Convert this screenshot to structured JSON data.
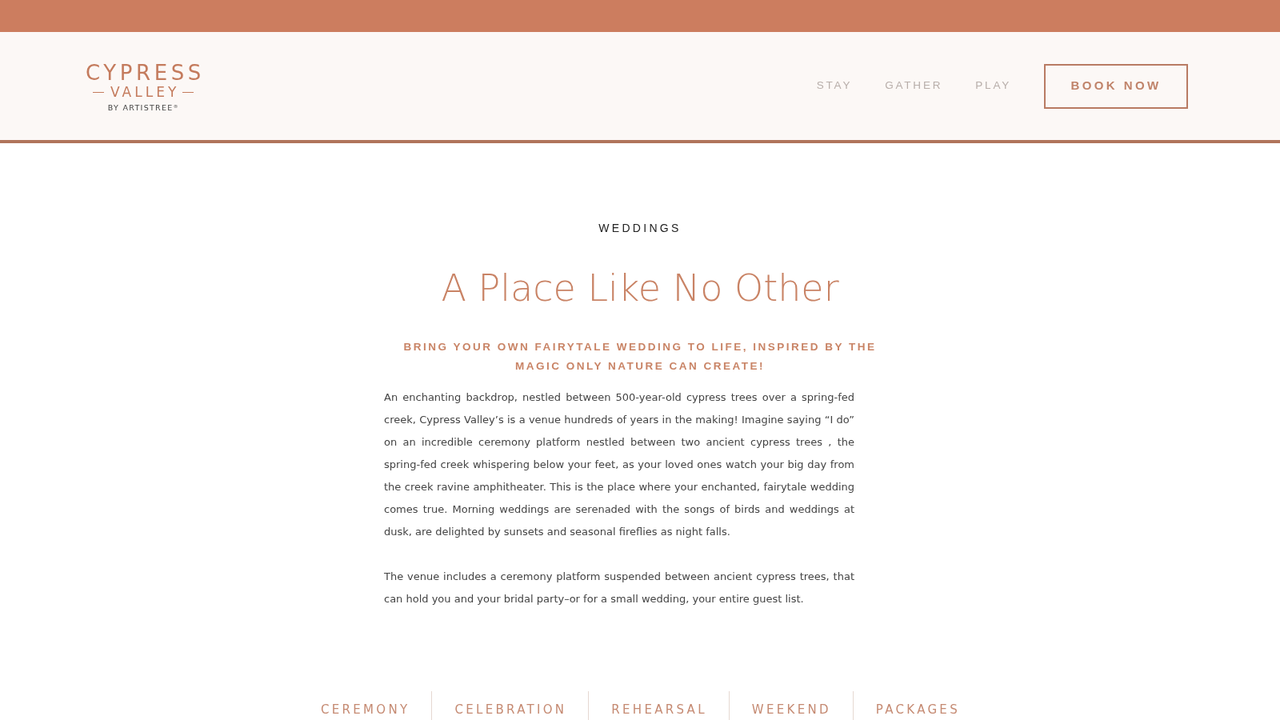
{
  "logo": {
    "line_1": "CYPRESS",
    "line_2": "VALLEY",
    "line_3": "BY ARTISTREE$^{®}$"
  },
  "nav": {
    "items": [
      {
        "label": "STAY"
      },
      {
        "label": "GATHER"
      },
      {
        "label": "PLAY"
      }
    ],
    "cta": "BOOK NOW"
  },
  "hero": {
    "eyebrow": "WEDDINGS",
    "title": "A Place Like No Other",
    "subtitle": "BRING YOUR OWN FAIRYTALE WEDDING TO LIFE, INSPIRED BY THE MAGIC ONLY NATURE CAN CREATE!",
    "paragraphs": [
      "An enchanting backdrop, nestled between 500-year-old cypress trees over a spring-fed creek, Cypress Valley’s is a venue hundreds of years in the making! Imagine saying “I do” on an incredible ceremony platform nestled between two ancient cypress trees , the spring-fed creek whispering below your feet, as your loved ones watch your big day from the creek ravine amphitheater. This is the place where your enchanted, fairytale wedding comes true. Morning weddings are serenaded with the songs of birds and weddings at dusk, are delighted by sunsets and seasonal fireflies as night falls.",
      "The venue includes a ceremony platform suspended between ancient cypress trees, that can hold you and your bridal party–or for a small wedding, your entire guest list."
    ]
  },
  "tabs": [
    {
      "label": "CEREMONY"
    },
    {
      "label": "CELEBRATION"
    },
    {
      "label": "REHEARSAL"
    },
    {
      "label": "WEEKEND"
    },
    {
      "label": "PACKAGES"
    }
  ]
}
